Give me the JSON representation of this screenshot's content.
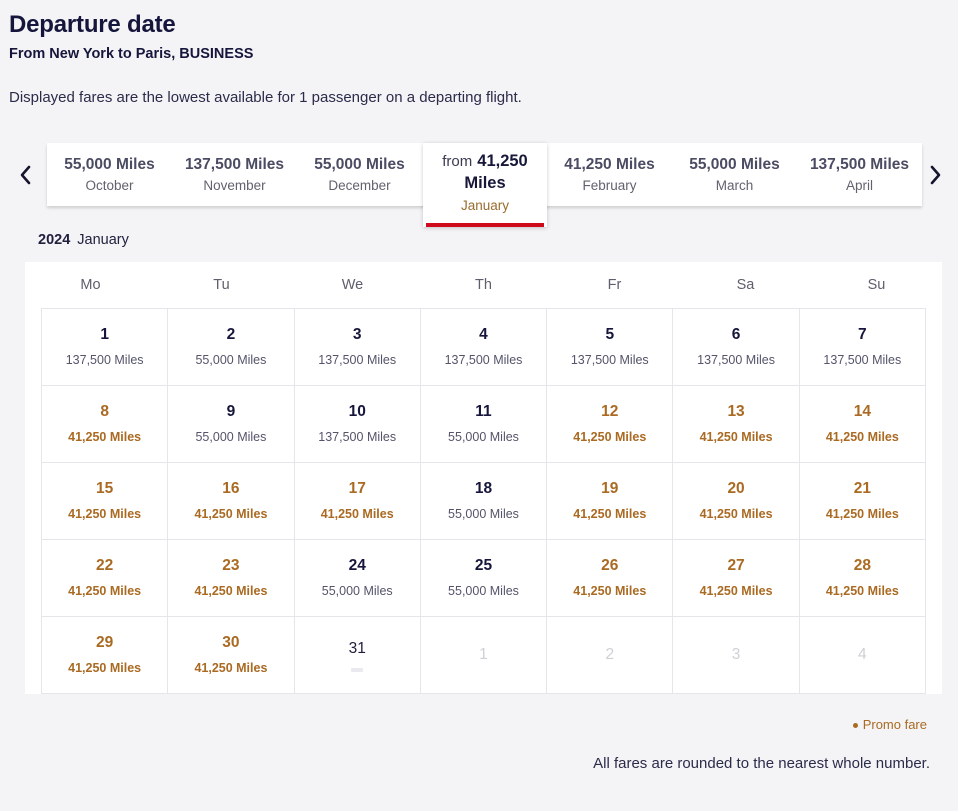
{
  "header": {
    "title": "Departure date",
    "subtitle": "From New York to Paris, BUSINESS",
    "intro": "Displayed fares are the lowest available for 1 passenger on a departing flight."
  },
  "carousel": {
    "prev_icon": "chevron-left-icon",
    "next_icon": "chevron-right-icon",
    "months_before": [
      {
        "miles": "55,000 Miles",
        "month": "October"
      },
      {
        "miles": "137,500 Miles",
        "month": "November"
      },
      {
        "miles": "55,000 Miles",
        "month": "December"
      }
    ],
    "active": {
      "from_word": "from",
      "amount": "41,250",
      "unit": "Miles",
      "month": "January",
      "underline_color": "#cf0a1b"
    },
    "months_after": [
      {
        "miles": "41,250 Miles",
        "month": "February"
      },
      {
        "miles": "55,000 Miles",
        "month": "March"
      },
      {
        "miles": "137,500 Miles",
        "month": "April"
      }
    ]
  },
  "calendar": {
    "year": "2024",
    "month": "January",
    "weekdays": [
      "Mo",
      "Tu",
      "We",
      "Th",
      "Fr",
      "Sa",
      "Su"
    ],
    "weeks": [
      [
        {
          "day": "1",
          "fare": "137,500 Miles",
          "state": "normal"
        },
        {
          "day": "2",
          "fare": "55,000 Miles",
          "state": "normal"
        },
        {
          "day": "3",
          "fare": "137,500 Miles",
          "state": "normal"
        },
        {
          "day": "4",
          "fare": "137,500 Miles",
          "state": "normal"
        },
        {
          "day": "5",
          "fare": "137,500 Miles",
          "state": "normal"
        },
        {
          "day": "6",
          "fare": "137,500 Miles",
          "state": "normal"
        },
        {
          "day": "7",
          "fare": "137,500 Miles",
          "state": "normal"
        }
      ],
      [
        {
          "day": "8",
          "fare": "41,250 Miles",
          "state": "promo"
        },
        {
          "day": "9",
          "fare": "55,000 Miles",
          "state": "normal"
        },
        {
          "day": "10",
          "fare": "137,500 Miles",
          "state": "normal"
        },
        {
          "day": "11",
          "fare": "55,000 Miles",
          "state": "normal"
        },
        {
          "day": "12",
          "fare": "41,250 Miles",
          "state": "promo"
        },
        {
          "day": "13",
          "fare": "41,250 Miles",
          "state": "promo"
        },
        {
          "day": "14",
          "fare": "41,250 Miles",
          "state": "promo"
        }
      ],
      [
        {
          "day": "15",
          "fare": "41,250 Miles",
          "state": "promo"
        },
        {
          "day": "16",
          "fare": "41,250 Miles",
          "state": "promo"
        },
        {
          "day": "17",
          "fare": "41,250 Miles",
          "state": "promo"
        },
        {
          "day": "18",
          "fare": "55,000 Miles",
          "state": "normal"
        },
        {
          "day": "19",
          "fare": "41,250 Miles",
          "state": "promo"
        },
        {
          "day": "20",
          "fare": "41,250 Miles",
          "state": "promo"
        },
        {
          "day": "21",
          "fare": "41,250 Miles",
          "state": "promo"
        }
      ],
      [
        {
          "day": "22",
          "fare": "41,250 Miles",
          "state": "promo"
        },
        {
          "day": "23",
          "fare": "41,250 Miles",
          "state": "promo"
        },
        {
          "day": "24",
          "fare": "55,000 Miles",
          "state": "normal"
        },
        {
          "day": "25",
          "fare": "55,000 Miles",
          "state": "normal"
        },
        {
          "day": "26",
          "fare": "41,250 Miles",
          "state": "promo"
        },
        {
          "day": "27",
          "fare": "41,250 Miles",
          "state": "promo"
        },
        {
          "day": "28",
          "fare": "41,250 Miles",
          "state": "promo"
        }
      ],
      [
        {
          "day": "29",
          "fare": "41,250 Miles",
          "state": "promo"
        },
        {
          "day": "30",
          "fare": "41,250 Miles",
          "state": "promo"
        },
        {
          "day": "31",
          "fare": "",
          "state": "plain"
        },
        {
          "day": "1",
          "fare": "",
          "state": "muted"
        },
        {
          "day": "2",
          "fare": "",
          "state": "muted"
        },
        {
          "day": "3",
          "fare": "",
          "state": "muted"
        },
        {
          "day": "4",
          "fare": "",
          "state": "muted"
        }
      ]
    ]
  },
  "footer": {
    "promo_legend": "Promo fare",
    "promo_color": "#aa6a22",
    "rounding_note": "All fares are rounded to the nearest whole number."
  }
}
